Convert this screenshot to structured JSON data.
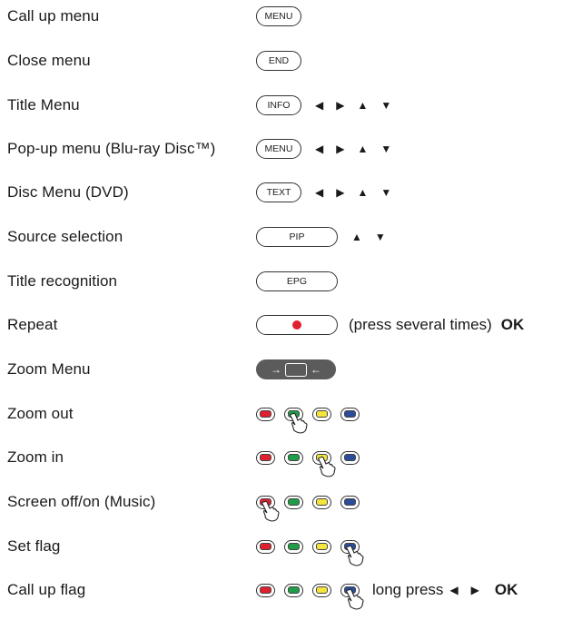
{
  "colors": {
    "red": "#e0202e",
    "green": "#1f9d47",
    "yellow": "#f3e53b",
    "blue": "#2b4c9c",
    "record": "#e0202e"
  },
  "rows": [
    {
      "label": "Call up menu",
      "key": "MENU"
    },
    {
      "label": "Close menu",
      "key": "END"
    },
    {
      "label": "Title Menu",
      "key": "INFO"
    },
    {
      "label": "Pop-up menu (Blu-ray Disc™)",
      "key": "MENU"
    },
    {
      "label": "Disc Menu (DVD)",
      "key": "TEXT"
    },
    {
      "label": "Source selection",
      "key": "PIP"
    },
    {
      "label": "Title recognition",
      "key": "EPG"
    },
    {
      "label": "Repeat",
      "note": "(press several times)",
      "ok": "OK"
    },
    {
      "label": "Zoom Menu"
    },
    {
      "label": "Zoom out",
      "pressed": "green"
    },
    {
      "label": "Zoom in",
      "pressed": "yellow"
    },
    {
      "label": "Screen off/on (Music)",
      "pressed": "red"
    },
    {
      "label": "Set flag",
      "pressed": "blue"
    },
    {
      "label": "Call up flag",
      "pressed": "blue",
      "note": "long press",
      "ok": "OK"
    }
  ],
  "icons": {
    "left": "arrow-left-icon",
    "right": "arrow-right-icon",
    "up": "arrow-up-icon",
    "down": "arrow-down-icon",
    "hand": "pointing-hand-icon",
    "zoom": "zoom-screen-icon"
  }
}
